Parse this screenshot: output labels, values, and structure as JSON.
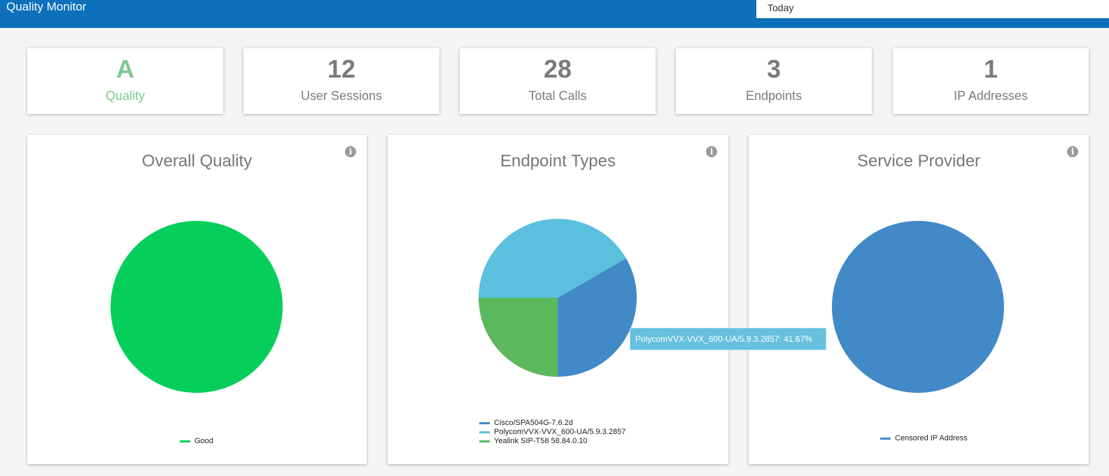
{
  "header": {
    "title": "Quality Monitor",
    "date_range": "Today"
  },
  "stats": [
    {
      "value": "A",
      "label": "Quality"
    },
    {
      "value": "12",
      "label": "User Sessions"
    },
    {
      "value": "28",
      "label": "Total Calls"
    },
    {
      "value": "3",
      "label": "Endpoints"
    },
    {
      "value": "1",
      "label": "IP Addresses"
    }
  ],
  "panels": [
    {
      "title": "Overall Quality",
      "info_icon": "info-icon"
    },
    {
      "title": "Endpoint Types",
      "info_icon": "info-icon"
    },
    {
      "title": "Service Provider",
      "info_icon": "info-icon"
    }
  ],
  "colors": {
    "header": "#0c70bb",
    "good": "#05cf5a",
    "cisco": "#4189c7",
    "polycom": "#5bc0de",
    "yealink": "#5cb85c",
    "provider": "#4189c7"
  },
  "tooltip": {
    "text": "PolycomVVX-VVX_600-UA/5.9.3.2857: 41.67%"
  },
  "chart_data": [
    {
      "type": "pie",
      "title": "Overall Quality",
      "labels": [
        "Good"
      ],
      "values": [
        100
      ],
      "colors": [
        "#05cf5a"
      ]
    },
    {
      "type": "pie",
      "title": "Endpoint Types",
      "labels": [
        "Cisco/SPA504G-7.6.2d",
        "PolycomVVX-VVX_600-UA/5.9.3.2857",
        "Yealink SIP-T58 58.84.0.10"
      ],
      "values": [
        33.33,
        41.67,
        25.0
      ],
      "colors": [
        "#4189c7",
        "#5bc0de",
        "#5cb85c"
      ]
    },
    {
      "type": "pie",
      "title": "Service Provider",
      "labels": [
        "Censored IP Address"
      ],
      "values": [
        100
      ],
      "colors": [
        "#4189c7"
      ]
    }
  ]
}
